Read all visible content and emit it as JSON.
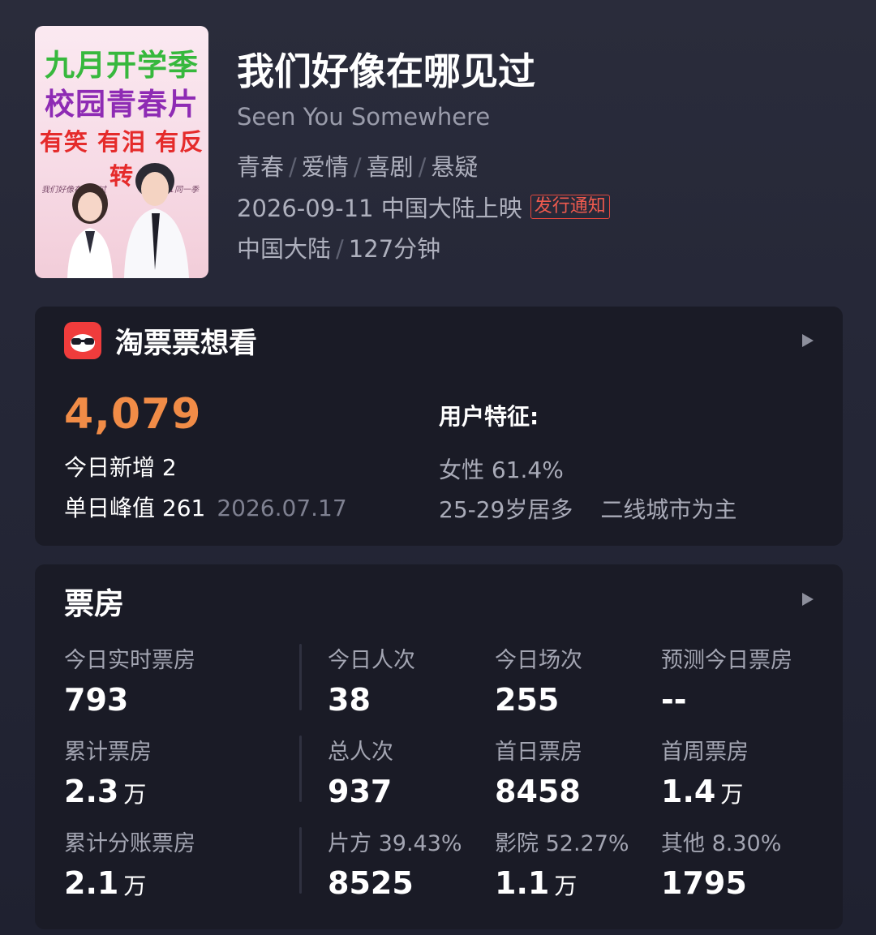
{
  "poster": {
    "line1": "九月开学季",
    "line2": "校园青春片",
    "line3": "有笑 有泪 有反转",
    "hand_left": "我们好像在哪见过",
    "hand_right": "待11同一季"
  },
  "movie": {
    "title": "我们好像在哪见过",
    "subtitle": "Seen You Somewhere",
    "genres": [
      "青春",
      "爱情",
      "喜剧",
      "悬疑"
    ],
    "release": "2026-09-11 中国大陆上映",
    "release_badge": "发行通知",
    "region": "中国大陆",
    "duration": "127分钟"
  },
  "want": {
    "title": "淘票票想看",
    "count": "4,079",
    "today_new": "今日新增 2",
    "peak": "单日峰值 261",
    "peak_date": "2026.07.17",
    "feature_title": "用户特征:",
    "female": "女性 61.4%",
    "age": "25-29岁居多",
    "city": "二线城市为主"
  },
  "boxoffice": {
    "title": "票房",
    "rows": [
      [
        {
          "label": "今日实时票房",
          "value": "793",
          "unit": ""
        },
        {
          "label": "今日人次",
          "value": "38",
          "unit": ""
        },
        {
          "label": "今日场次",
          "value": "255",
          "unit": ""
        },
        {
          "label": "预测今日票房",
          "value": "--",
          "unit": ""
        }
      ],
      [
        {
          "label": "累计票房",
          "value": "2.3",
          "unit": "万"
        },
        {
          "label": "总人次",
          "value": "937",
          "unit": ""
        },
        {
          "label": "首日票房",
          "value": "8458",
          "unit": ""
        },
        {
          "label": "首周票房",
          "value": "1.4",
          "unit": "万"
        }
      ],
      [
        {
          "label": "累计分账票房",
          "value": "2.1",
          "unit": "万"
        },
        {
          "label": "片方 39.43%",
          "value": "8525",
          "unit": ""
        },
        {
          "label": "影院 52.27%",
          "value": "1.1",
          "unit": "万"
        },
        {
          "label": "其他 8.30%",
          "value": "1795",
          "unit": ""
        }
      ]
    ]
  },
  "colors": {
    "accent_orange": "#f18c47",
    "badge_red": "#ef5a4e",
    "card_bg": "#1a1b26"
  }
}
